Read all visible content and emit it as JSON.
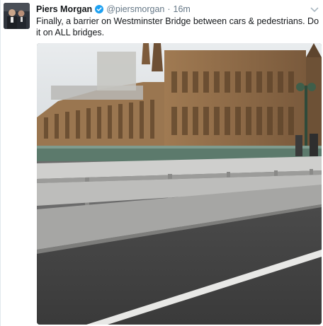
{
  "tweet": {
    "author_name": "Piers Morgan",
    "author_handle": "@piersmorgan",
    "separator": "·",
    "timestamp": "16m",
    "text": "Finally, a barrier on Westminster Bridge between cars & pedestrians. Do it on ALL bridges.",
    "verified": true
  },
  "icons": {
    "verified": "verified-badge-icon",
    "menu": "chevron-down-icon"
  },
  "colors": {
    "name": "#14171a",
    "meta": "#657786",
    "verified": "#1da1f2"
  }
}
